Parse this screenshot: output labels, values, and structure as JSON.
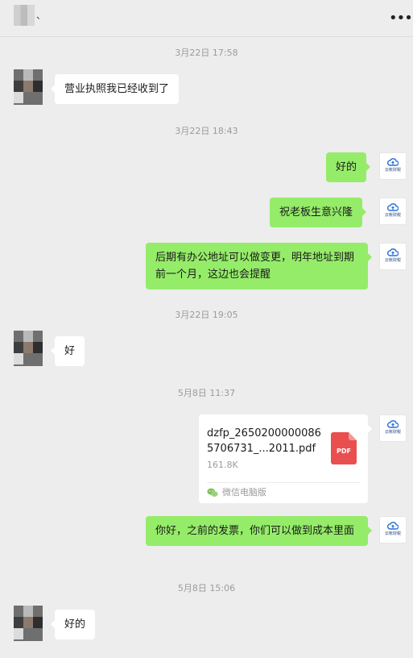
{
  "header": {
    "title_mark": "、",
    "more_label": "•••"
  },
  "messages": {
    "t1": "3月22日 17:58",
    "m1": "营业执照我已经收到了",
    "t2": "3月22日 18:43",
    "m2": "好的",
    "m3": "祝老板生意兴隆",
    "m4": "后期有办公地址可以做变更，明年地址到期前一个月，这边也会提醒",
    "t3": "3月22日 19:05",
    "m5": "好",
    "t4": "5月8日 11:37",
    "file": {
      "name": "dzfp_26502000000865706731_...2011.pdf",
      "size": "161.8K",
      "badge": "PDF",
      "source": "微信电脑版"
    },
    "m6": "你好，之前的发票，你们可以做到成本里面",
    "t5": "5月8日 15:06",
    "m7": "好的"
  },
  "avatar_right_label": "云帐财税",
  "colors": {
    "background": "#ededed",
    "bubble_sent": "#95ec69",
    "bubble_received": "#ffffff",
    "pdf_red": "#e94f4f",
    "cloud_blue": "#2a6fd6"
  }
}
